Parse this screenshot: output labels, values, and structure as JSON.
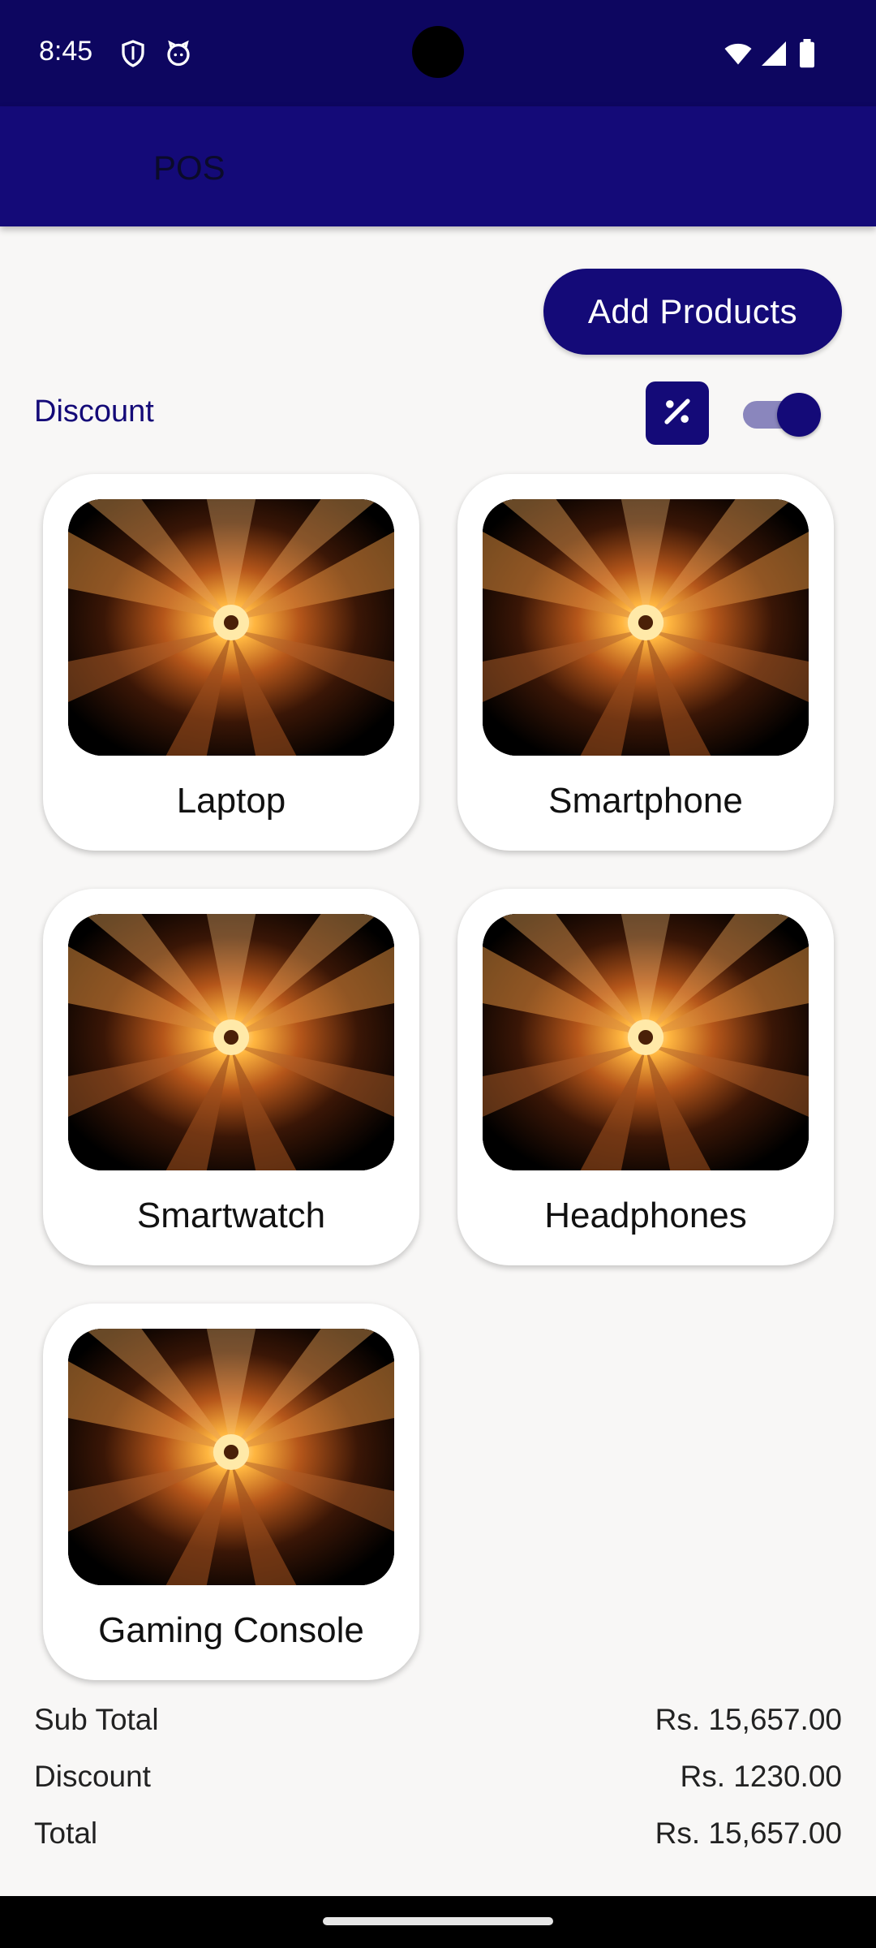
{
  "status_bar": {
    "time": "8:45",
    "icons": [
      "shield-icon",
      "cat-face-icon",
      "wifi-icon",
      "signal-icon",
      "battery-icon"
    ]
  },
  "app_bar": {
    "title": "POS"
  },
  "actions": {
    "add_products_label": "Add Products"
  },
  "discount": {
    "label": "Discount",
    "percent_icon": "percent-icon",
    "toggle_on": true
  },
  "products": [
    {
      "name": "Laptop"
    },
    {
      "name": "Smartphone"
    },
    {
      "name": "Smartwatch"
    },
    {
      "name": "Headphones"
    },
    {
      "name": "Gaming Console"
    }
  ],
  "summary": {
    "subtotal_label": "Sub Total",
    "subtotal_value": "Rs. 15,657.00",
    "discount_label": "Discount",
    "discount_value": "Rs. 1230.00",
    "total_label": "Total",
    "total_value": "Rs. 15,657.00"
  },
  "colors": {
    "primary": "#140a78",
    "status_bar": "#0d0660",
    "background": "#f8f7f6"
  }
}
